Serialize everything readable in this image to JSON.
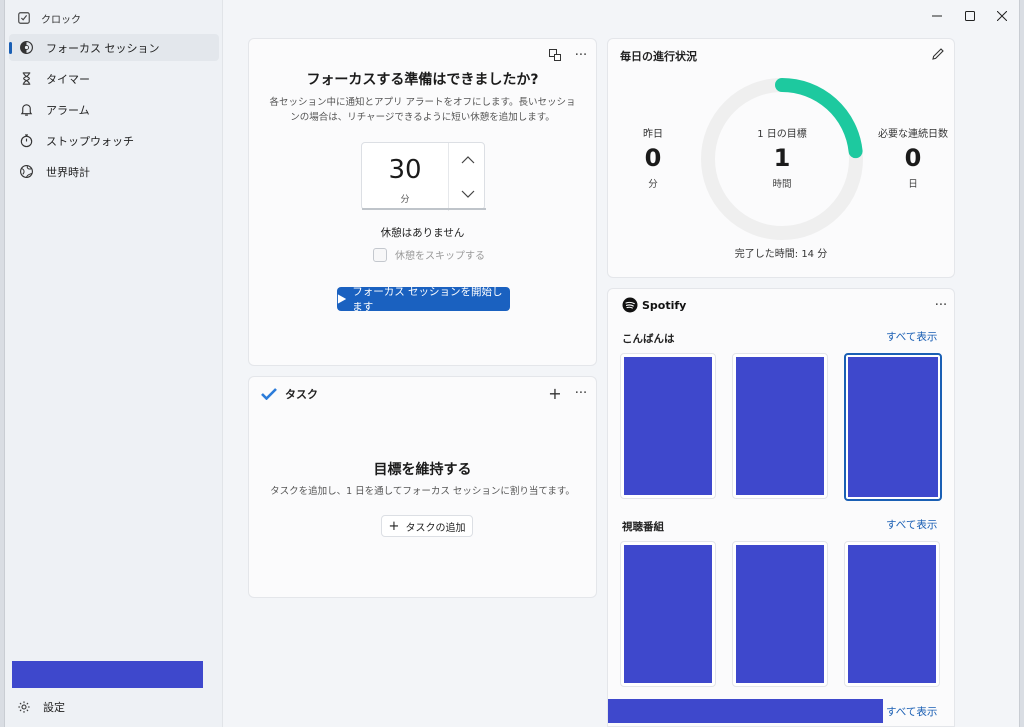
{
  "window": {
    "app_title": "クロック",
    "controls": [
      "minimize",
      "maximize",
      "close"
    ]
  },
  "sidebar": {
    "items": [
      {
        "label": "フォーカス セッション",
        "icon": "focus-icon",
        "active": true
      },
      {
        "label": "タイマー",
        "icon": "hourglass-icon",
        "active": false
      },
      {
        "label": "アラーム",
        "icon": "bell-icon",
        "active": false
      },
      {
        "label": "ストップウォッチ",
        "icon": "stopwatch-icon",
        "active": false
      },
      {
        "label": "世界時計",
        "icon": "globe-icon",
        "active": false
      }
    ],
    "settings_label": "設定"
  },
  "focus": {
    "title": "フォーカスする準備はできましたか?",
    "description": "各セッション中に通知とアプリ アラートをオフにします。長いセッションの場合は、リチャージできるように短い休憩を追加します。",
    "minutes_value": "30",
    "minutes_unit": "分",
    "break_text": "休憩はありません",
    "skip_break_label": "休憩をスキップする",
    "start_button": "フォーカス セッションを開始します"
  },
  "tasks": {
    "header": "タスク",
    "title": "目標を維持する",
    "description": "タスクを追加し、1 日を通してフォーカス セッションに割り当てます。",
    "add_button": "タスクの追加"
  },
  "progress": {
    "title": "毎日の進行状況",
    "yesterday": {
      "label": "昨日",
      "value": "0",
      "unit": "分"
    },
    "goal": {
      "label": "1 日の目標",
      "value": "1",
      "unit": "時間"
    },
    "streak": {
      "label": "必要な連続日数",
      "value": "0",
      "unit": "日"
    },
    "completed": "完了した時間: 14 分",
    "ring_fraction": 0.233,
    "ring_color": "#1dc99f"
  },
  "spotify": {
    "brand": "Spotify",
    "section1": {
      "title": "こんばんは",
      "see_all": "すべて表示"
    },
    "section2": {
      "title": "視聴番組",
      "see_all": "すべて表示"
    },
    "section3": {
      "see_all": "すべて表示"
    }
  },
  "colors": {
    "accent": "#1a61c0",
    "redaction": "#3e48cc"
  }
}
